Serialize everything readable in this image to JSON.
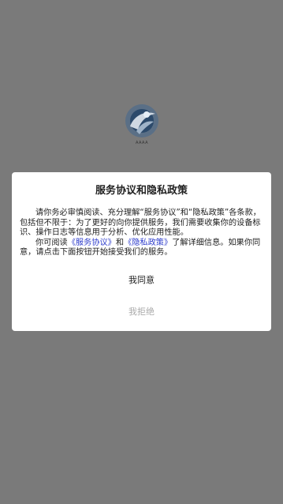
{
  "brand": {
    "logo_text": "AAAA",
    "accent_color": "#2e5a8a"
  },
  "dialog": {
    "title": "服务协议和隐私政策",
    "para1": "请你务必审慎阅读、充分理解“服务协议”和“隐私政策”各条款，包括但不限于：为了更好的向你提供服务，我们需要收集你的设备标识、操作日志等信息用于分析、优化应用性能。",
    "para2_prefix": "你可阅读",
    "link_service": "《服务协议》",
    "para2_and": "和",
    "link_privacy": "《隐私政策》",
    "para2_suffix": "了解详细信息。如果你同意，请点击下面按钮开始接受我们的服务。",
    "agree_label": "我同意",
    "reject_label": "我拒绝",
    "link_color": "#2e3dcc"
  }
}
